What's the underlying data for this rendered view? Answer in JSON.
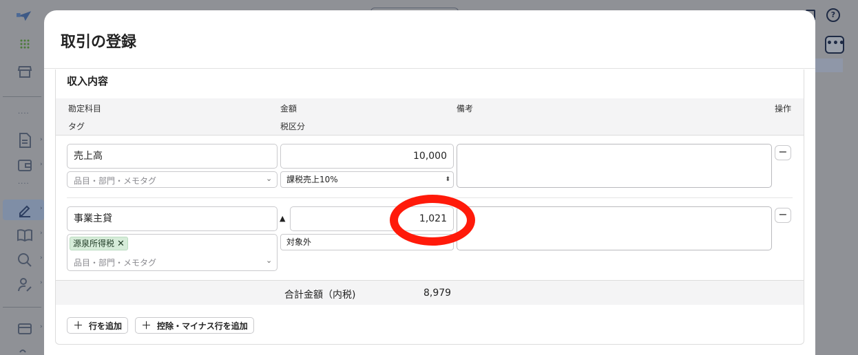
{
  "modal": {
    "title": "取引の登録"
  },
  "section": {
    "title": "収入内容"
  },
  "headers": {
    "account": "勘定科目",
    "amount": "金額",
    "note": "備考",
    "action": "操作",
    "tag": "タグ",
    "tax": "税区分"
  },
  "rows": [
    {
      "account": "売上高",
      "amount": "10,000",
      "tag_placeholder": "品目・部門・メモタグ",
      "tax": "課税売上10%"
    },
    {
      "account": "事業主貸",
      "deduction_mark": "▲",
      "amount": "1,021",
      "chip": "源泉所得税",
      "tag_placeholder": "品目・部門・メモタグ",
      "tax": "対象外"
    }
  ],
  "total": {
    "label": "合計金額（内税)",
    "value": "8,979"
  },
  "buttons": {
    "add_row": "行を追加",
    "add_deduction_row": "控除・マイナス行を追加",
    "more": "•••"
  },
  "icons": {
    "remove": "−",
    "chip_close": "✕",
    "chevron": "⌄",
    "plus": "＋",
    "help": "?"
  },
  "colors": {
    "highlight_ring": "#ff1a0a",
    "chip_bg": "#d6ecd9",
    "overlay": "#8f9196"
  }
}
